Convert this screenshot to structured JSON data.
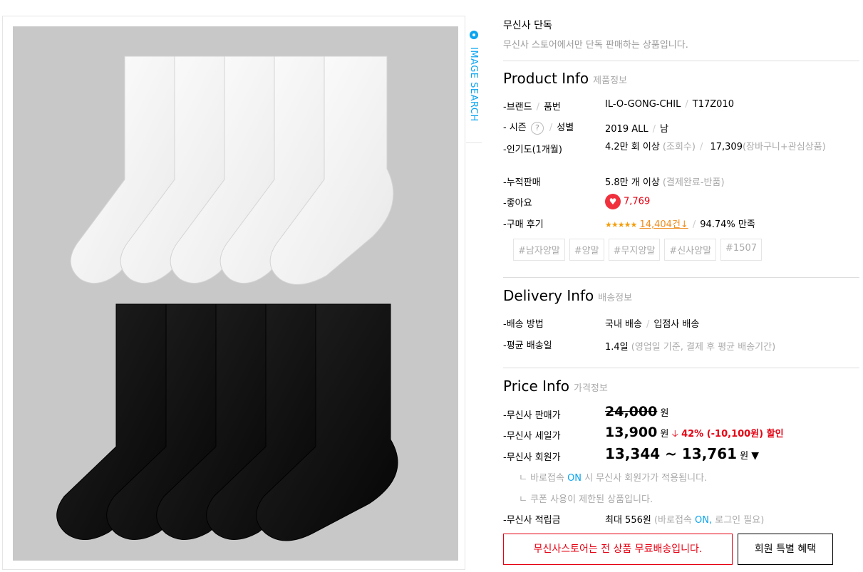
{
  "image_search_label": "IMAGE SEARCH",
  "exclusive": {
    "title": "무신사 단독",
    "desc": "무신사 스토어에서만 단독 판매하는 상품입니다."
  },
  "product_info": {
    "title": "Product Info",
    "subtitle": "제품정보",
    "brand_label": "-브랜드",
    "number_label": "품번",
    "brand": "IL-O-GONG-CHIL",
    "number": "T17Z010",
    "season_label": "- 시즌",
    "gender_label": "성별",
    "season": "2019 ALL",
    "gender": "남",
    "popularity_label": "-인기도(1개월)",
    "views": "4.2만 회 이상",
    "views_note": "(조회수)",
    "cart": "17,309",
    "cart_note": "(장바구니+관심상품)",
    "sales_label": "-누적판매",
    "sales": "5.8만 개 이상",
    "sales_note": "(결제완료-반품)",
    "likes_label": "-좋아요",
    "likes": "7,769",
    "review_label": "-구매 후기",
    "stars": "★★★★★",
    "review_count": "14,404건",
    "satisfaction": "94.74% 만족",
    "tags": [
      "#남자양말",
      "#양말",
      "#무지양말",
      "#신사양말",
      "#1507"
    ]
  },
  "delivery_info": {
    "title": "Delivery Info",
    "subtitle": "배송정보",
    "method_label": "-배송 방법",
    "method_a": "국내 배송",
    "method_b": "입점사 배송",
    "avg_label": "-평균 배송일",
    "avg": "1.4일",
    "avg_note": "(영업일 기준, 결제 후 평균 배송기간)"
  },
  "price_info": {
    "title": "Price Info",
    "subtitle": "가격정보",
    "sale_price_label": "-무신사 판매가",
    "sale_price": "24,000",
    "won": "원",
    "discount_label": "-무신사 세일가",
    "discount_price": "13,900",
    "discount_rate": "42% (-10,100원) 할인",
    "member_label": "-무신사 회원가",
    "member_price": "13,344 ~ 13,761",
    "note1_prefix": "ㄴ 바로접속",
    "note1_on": "ON",
    "note1_suffix": "시 무신사 회원가가 적용됩니다.",
    "note2": "ㄴ 쿠폰 사용이 제한된 상품입니다.",
    "points_label": "-무신사 적립금",
    "points": "최대 556원",
    "points_note_prefix": "(바로접속",
    "points_note_on": "ON,",
    "points_note_suffix": "로그인 필요)"
  },
  "buttons": {
    "free_shipping": "무신사스토어는 전 상품 무료배송입니다.",
    "member_benefit": "회원 특별 혜택"
  },
  "colors": {
    "accent_red": "#e60012",
    "accent_blue": "#0aa4f0",
    "review_orange": "#f08d1d"
  }
}
